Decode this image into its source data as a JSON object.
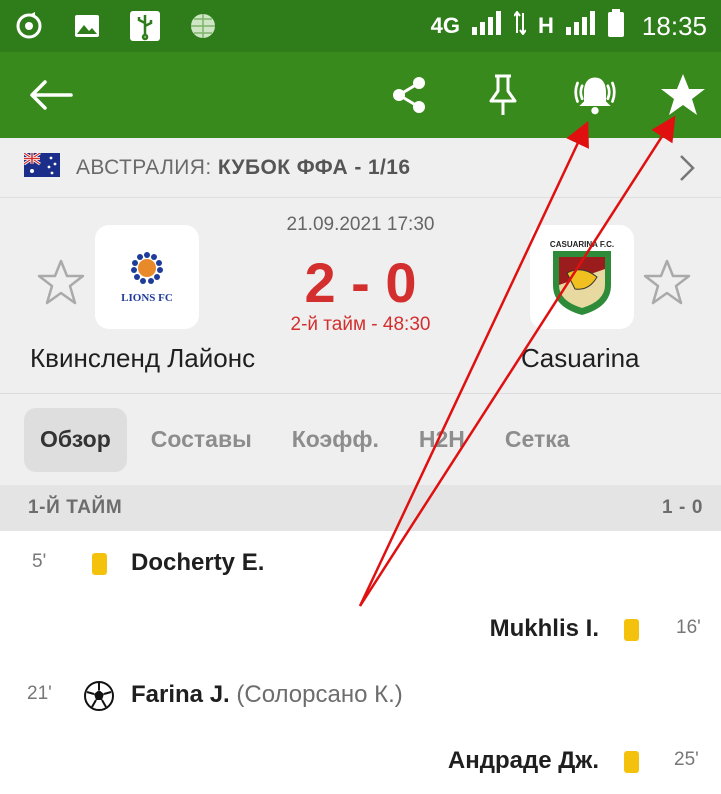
{
  "status_bar": {
    "network_1": "4G",
    "network_2": "H",
    "time": "18:35",
    "icons": [
      "sync-icon",
      "image-icon",
      "usb-icon",
      "globe-icon",
      "signal-icon",
      "signal-icon",
      "battery-icon"
    ]
  },
  "app_bar": {
    "color": "#398a1c",
    "icons": [
      "back-arrow-icon",
      "share-icon",
      "pin-icon",
      "bell-icon",
      "star-icon"
    ]
  },
  "competition": {
    "country": "АВСТРАЛИЯ:",
    "name": "КУБОК ФФА - 1/16"
  },
  "match": {
    "datetime": "21.09.2021 17:30",
    "score": "2 - 0",
    "period": "2-й тайм - 48:30",
    "home_team": "Квинсленд Лайонс",
    "home_logo_text": "LIONS FC",
    "away_team": "Casuarina",
    "away_logo_text": "CASUARINA F.C."
  },
  "tabs": [
    {
      "label": "Обзор",
      "active": true
    },
    {
      "label": "Составы",
      "active": false
    },
    {
      "label": "Коэфф.",
      "active": false
    },
    {
      "label": "H2H",
      "active": false
    },
    {
      "label": "Сетка",
      "active": false
    }
  ],
  "section": {
    "title": "1-Й ТАЙМ",
    "score": "1 - 0"
  },
  "events": [
    {
      "minute": "5'",
      "side": "home",
      "type": "yellow-card",
      "player": "Docherty E.",
      "assist": ""
    },
    {
      "minute": "16'",
      "side": "away",
      "type": "yellow-card",
      "player": "Mukhlis I.",
      "assist": ""
    },
    {
      "minute": "21'",
      "side": "home",
      "type": "goal",
      "player": "Farina J.",
      "assist": "(Солорсано К.)"
    },
    {
      "minute": "25'",
      "side": "away",
      "type": "yellow-card",
      "player": "Андраде Дж.",
      "assist": ""
    }
  ],
  "colors": {
    "accent_green": "#398a1c",
    "score_red": "#d32f2f",
    "yellow_card": "#f4c20d",
    "annotation_red": "#e01010"
  }
}
